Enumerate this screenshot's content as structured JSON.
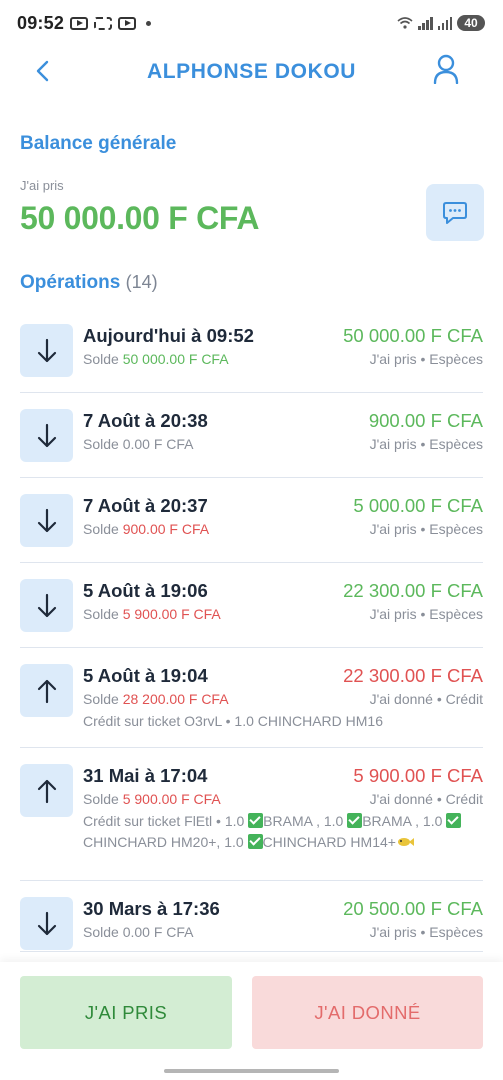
{
  "status_bar": {
    "time": "09:52",
    "battery": "40",
    "icons": [
      "youtube-icon",
      "screen-capture-icon",
      "youtube-icon",
      "notification-dot",
      "wifi-icon",
      "signal-icon",
      "signal-icon",
      "battery-icon"
    ]
  },
  "header": {
    "title": "ALPHONSE DOKOU",
    "back_icon": "chevron-left-icon",
    "profile_icon": "user-icon"
  },
  "balance": {
    "title": "Balance générale",
    "sub": "J'ai pris",
    "amount": "50 000.00 F CFA",
    "chat_icon": "chat-bubble-icon"
  },
  "operations": {
    "title": "Opérations",
    "count": "(14)",
    "items": [
      {
        "direction": "down",
        "date": "Aujourd'hui à 09:52",
        "solde_label": "Solde",
        "solde_value": "50 000.00 F CFA",
        "solde_color": "green",
        "amount": "50 000.00 F CFA",
        "amount_color": "green",
        "meta": "J'ai pris • Espèces",
        "note": ""
      },
      {
        "direction": "down",
        "date": "7 Août à 20:38",
        "solde_label": "Solde",
        "solde_value": "0.00 F CFA",
        "solde_color": "grey",
        "amount": "900.00 F CFA",
        "amount_color": "green",
        "meta": "J'ai pris • Espèces",
        "note": ""
      },
      {
        "direction": "down",
        "date": "7 Août à 20:37",
        "solde_label": "Solde",
        "solde_value": "900.00 F CFA",
        "solde_color": "red",
        "amount": "5 000.00 F CFA",
        "amount_color": "green",
        "meta": "J'ai pris • Espèces",
        "note": ""
      },
      {
        "direction": "down",
        "date": "5 Août à 19:06",
        "solde_label": "Solde",
        "solde_value": "5 900.00 F CFA",
        "solde_color": "red",
        "amount": "22 300.00 F CFA",
        "amount_color": "green",
        "meta": "J'ai pris • Espèces",
        "note": ""
      },
      {
        "direction": "up",
        "date": "5 Août à 19:04",
        "solde_label": "Solde",
        "solde_value": "28 200.00 F CFA",
        "solde_color": "red",
        "amount": "22 300.00 F CFA",
        "amount_color": "red",
        "meta": "J'ai donné • Crédit",
        "note": "Crédit sur ticket O3rvL • 1.0 CHINCHARD HM16"
      },
      {
        "direction": "up",
        "date": "31 Mai à 17:04",
        "solde_label": "Solde",
        "solde_value": "5 900.00 F CFA",
        "solde_color": "red",
        "amount": "5 900.00 F CFA",
        "amount_color": "red",
        "meta": "J'ai donné • Crédit",
        "note_parts": [
          "Crédit sur ticket FlEtl • 1.0 ",
          "BRAMA , 1.0 ",
          "BRAMA , 1.0 ",
          "CHINCHARD HM20+, 1.0 ",
          "CHINCHARD HM14+"
        ]
      },
      {
        "direction": "down",
        "date": "30 Mars à 17:36",
        "solde_label": "Solde",
        "solde_value": "0.00 F CFA",
        "solde_color": "grey",
        "amount": "20 500.00 F CFA",
        "amount_color": "green",
        "meta": "J'ai pris • Espèces",
        "note": ""
      }
    ]
  },
  "actions": {
    "took_label": "J'AI PRIS",
    "gave_label": "J'AI DONNÉ"
  },
  "colors": {
    "accent": "#3b8fdc",
    "green": "#5cb85c",
    "red": "#e05252",
    "icon_bg": "#dcebfa"
  }
}
